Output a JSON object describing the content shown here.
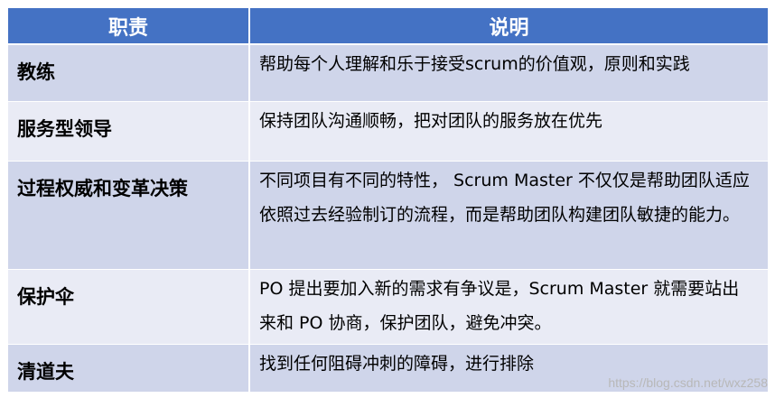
{
  "table": {
    "headers": [
      "职责",
      "说明"
    ],
    "rows": [
      {
        "role": "教练",
        "desc": "帮助每个人理解和乐于接受scrum的价值观，原则和实践"
      },
      {
        "role": "服务型领导",
        "desc": "保持团队沟通顺畅，把对团队的服务放在优先"
      },
      {
        "role": "过程权威和变革决策",
        "desc": "不同项目有不同的特性， Scrum Master 不仅仅是帮助团队适应依照过去经验制订的流程，而是帮助团队构建团队敏捷的能力。"
      },
      {
        "role": "保护伞",
        "desc": "PO 提出要加入新的需求有争议是，Scrum Master 就需要站出来和 PO 协商，保护团队，避免冲突。"
      },
      {
        "role": "清道夫",
        "desc": "找到任何阻碍冲刺的障碍，进行排除"
      }
    ]
  },
  "watermark": "https://blog.csdn.net/wxz258",
  "colors": {
    "header_bg": "#4472c4",
    "row_dark": "#cfd5ea",
    "row_light": "#e9ebf5"
  }
}
